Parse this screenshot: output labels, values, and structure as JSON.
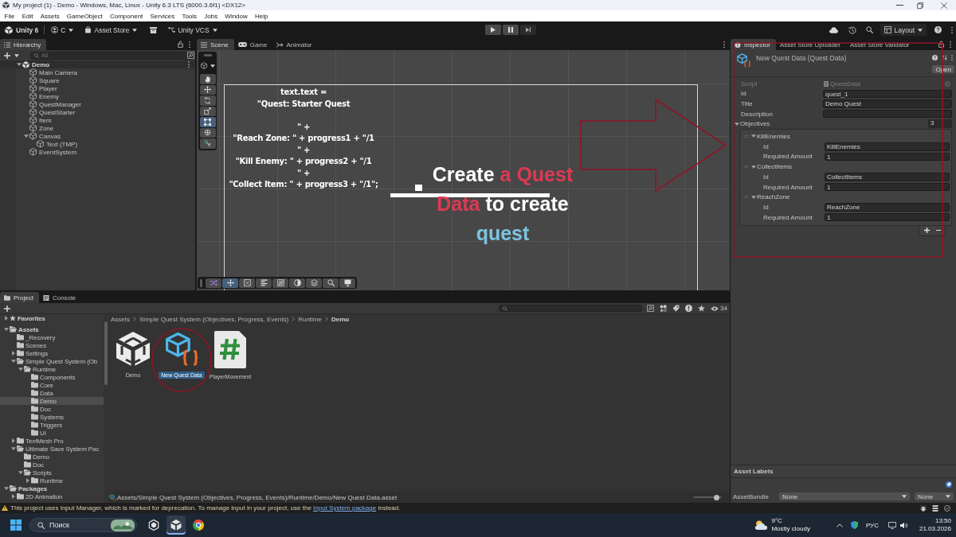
{
  "window": {
    "title": "My project (1) - Demo - Windows, Mac, Linux - Unity 6.3 LTS (6000.3.6f1) <DX12>"
  },
  "menu": [
    "File",
    "Edit",
    "Assets",
    "GameObject",
    "Component",
    "Services",
    "Tools",
    "Jobs",
    "Window",
    "Help"
  ],
  "toolbar": {
    "account": "Unity 6",
    "user": "C",
    "asset_store": "Asset Store",
    "version_control": "Unity VCS",
    "layout": "Layout"
  },
  "hierarchy": {
    "tabs": [
      {
        "label": "Hierarchy",
        "selected": true
      }
    ],
    "search": {
      "placeholder": "All"
    },
    "scene": {
      "name": "Demo",
      "expanded": true,
      "children": [
        {
          "name": "Main Camera"
        },
        {
          "name": "Square"
        },
        {
          "name": "Player"
        },
        {
          "name": "Enemy"
        },
        {
          "name": "QuestManager"
        },
        {
          "name": "QuestStarter"
        },
        {
          "name": "Item"
        },
        {
          "name": "Zone"
        },
        {
          "name": "Canvas",
          "expanded": true,
          "children": [
            {
              "name": "Text (TMP)"
            }
          ]
        },
        {
          "name": "EventSystem"
        }
      ]
    }
  },
  "scene_view": {
    "tabs": [
      {
        "label": "Scene",
        "kind": "scene",
        "selected": true
      },
      {
        "label": "Game",
        "kind": "game",
        "selected": false
      },
      {
        "label": "Animator",
        "kind": "animator",
        "selected": false
      }
    ],
    "tools": [
      {
        "kind": "hand",
        "selected": false
      },
      {
        "kind": "move",
        "selected": false
      },
      {
        "kind": "rotate",
        "selected": false
      },
      {
        "kind": "scale",
        "selected": false
      },
      {
        "kind": "rect",
        "selected": true
      },
      {
        "kind": "transform",
        "selected": false
      },
      {
        "kind": "custom",
        "selected": false
      }
    ],
    "overlay_tools": [
      {
        "kind": "shuffle",
        "selected": false
      },
      {
        "kind": "move",
        "selected": true
      },
      {
        "kind": "cross",
        "selected": false
      },
      {
        "kind": "align",
        "selected": false
      },
      {
        "kind": "grid",
        "selected": false
      },
      {
        "kind": "circle",
        "selected": false
      },
      {
        "kind": "layers",
        "selected": false
      },
      {
        "kind": "search",
        "selected": false
      },
      {
        "kind": "display",
        "selected": false
      }
    ],
    "text_blocks": [
      [
        "text.text =",
        "\"Quest: Starter Quest"
      ],
      [
        "\" +",
        "\"Reach Zone: \" + progress1 + \"/1",
        "\" +",
        "\"Kill Enemy: \" + progress2 + \"/1",
        "\" +",
        "\"Collect Item: \" + progress3 + \"/1\";"
      ]
    ],
    "annotation": {
      "lines": [
        [
          {
            "text": "Create",
            "color": "#ffffff"
          },
          {
            "text": "a Quest",
            "color": "#dc3a52"
          }
        ],
        [
          {
            "text": "Data",
            "color": "#dc3a52"
          },
          {
            "text": "to create",
            "color": "#ffffff"
          }
        ],
        [
          {
            "text": "quest",
            "color": "#7cc4e0"
          }
        ]
      ]
    }
  },
  "inspector": {
    "tabs": [
      {
        "label": "Inspector",
        "selected": true
      },
      {
        "label": "Asset Store Uploader",
        "selected": false
      },
      {
        "label": "Asset Store Validator",
        "selected": false
      }
    ],
    "title": "New Quest Data (Quest Data)",
    "open_button": "Open",
    "fields": [
      {
        "label": "Script",
        "kind": "object",
        "value": "QuestData",
        "disabled": true
      },
      {
        "label": "Id",
        "kind": "text",
        "value": "quest_1",
        "disabled": false
      },
      {
        "label": "Title",
        "kind": "text",
        "value": "Demo Quest",
        "disabled": false
      },
      {
        "label": "Description",
        "kind": "text",
        "disabled": false
      }
    ],
    "objectives": {
      "label": "Objectives",
      "count": "3",
      "expanded": true,
      "items": [
        {
          "name": "KillEnemies",
          "expanded": true,
          "fields": [
            {
              "label": "Id",
              "value": "KillEnemies"
            },
            {
              "label": "Required Amount",
              "value": "1"
            }
          ]
        },
        {
          "name": "CollectItems",
          "expanded": true,
          "fields": [
            {
              "label": "Id",
              "value": "CollectItems"
            },
            {
              "label": "Required Amount",
              "value": "1"
            }
          ]
        },
        {
          "name": "ReachZone",
          "expanded": true,
          "fields": [
            {
              "label": "Id",
              "value": "ReachZone"
            },
            {
              "label": "Required Amount",
              "value": "1"
            }
          ]
        }
      ]
    },
    "asset_labels": {
      "title": "Asset Labels",
      "bundle_label": "AssetBundle",
      "bundle": "None",
      "variant": "None"
    }
  },
  "project": {
    "tabs": [
      {
        "label": "Project",
        "kind": "project",
        "selected": true
      },
      {
        "label": "Console",
        "kind": "console",
        "selected": false
      }
    ],
    "count": "34",
    "tree": [
      {
        "name": "Favorites",
        "kind": "favorites",
        "expanded": false,
        "selected": false
      },
      {
        "name": "Assets",
        "kind": "folder",
        "expanded": true,
        "selected": false,
        "children": [
          {
            "name": "_Recovery",
            "kind": "folder",
            "selected": false
          },
          {
            "name": "Scenes",
            "kind": "folder",
            "selected": false
          },
          {
            "name": "Settings",
            "kind": "folder",
            "expanded": false,
            "selected": false
          },
          {
            "name": "Simple Quest System (Ob",
            "kind": "folder",
            "expanded": true,
            "selected": false,
            "children": [
              {
                "name": "Runtime",
                "kind": "folder",
                "expanded": true,
                "selected": false,
                "children": [
                  {
                    "name": "Components",
                    "kind": "folder",
                    "selected": false
                  },
                  {
                    "name": "Core",
                    "kind": "folder",
                    "selected": false
                  },
                  {
                    "name": "Data",
                    "kind": "folder",
                    "selected": false
                  },
                  {
                    "name": "Demo",
                    "kind": "folder",
                    "selected": true
                  },
                  {
                    "name": "Doc",
                    "kind": "folder",
                    "selected": false
                  },
                  {
                    "name": "Systems",
                    "kind": "folder",
                    "selected": false
                  },
                  {
                    "name": "Triggers",
                    "kind": "folder",
                    "selected": false
                  },
                  {
                    "name": "UI",
                    "kind": "folder",
                    "selected": false
                  }
                ]
              }
            ]
          },
          {
            "name": "TextMesh Pro",
            "kind": "folder",
            "expanded": false,
            "selected": false
          },
          {
            "name": "Ultimate Save System Pac",
            "kind": "folder",
            "expanded": true,
            "selected": false,
            "children": [
              {
                "name": "Demo",
                "kind": "folder",
                "selected": false
              },
              {
                "name": "Doc",
                "kind": "folder",
                "selected": false
              },
              {
                "name": "Scripts",
                "kind": "folder",
                "expanded": true,
                "selected": false,
                "children": [
                  {
                    "name": "Runtime",
                    "kind": "folder",
                    "expanded": false,
                    "selected": false
                  }
                ]
              }
            ]
          }
        ]
      },
      {
        "name": "Packages",
        "kind": "folder",
        "expanded": true,
        "selected": false,
        "children": [
          {
            "name": "2D Animation",
            "kind": "folder",
            "expanded": false,
            "selected": false
          }
        ]
      }
    ],
    "breadcrumb": [
      "Assets",
      "Simple Quest System (Objectives, Progress, Events)",
      "Runtime",
      "Demo"
    ],
    "assets": [
      {
        "name": "Demo",
        "kind": "scene",
        "selected": false
      },
      {
        "name": "New Quest Data",
        "kind": "scriptable-object",
        "selected": true
      },
      {
        "name": "PlayerMovement",
        "kind": "script",
        "selected": false
      }
    ],
    "path": "Assets/Simple Quest System (Objectives, Progress, Events)/Runtime/Demo/New Quest Data.asset",
    "icon_size": {
      "level": 0.83
    }
  },
  "status_bar": {
    "text_before": "This project uses Input Manager, which is marked for deprecation. To manage input in your project, use the ",
    "link": "Input System package",
    "text_after": " instead."
  },
  "taskbar": {
    "search": {
      "placeholder": "Поиск"
    },
    "apps": [
      {
        "kind": "hub",
        "active": false
      },
      {
        "kind": "unity",
        "active": true
      },
      {
        "kind": "browser",
        "active": false
      }
    ],
    "weather": {
      "temperature": "9°C",
      "condition": "Mostly cloudy"
    },
    "language": "РУС",
    "time": "13:50",
    "date": "21.03.2026"
  }
}
